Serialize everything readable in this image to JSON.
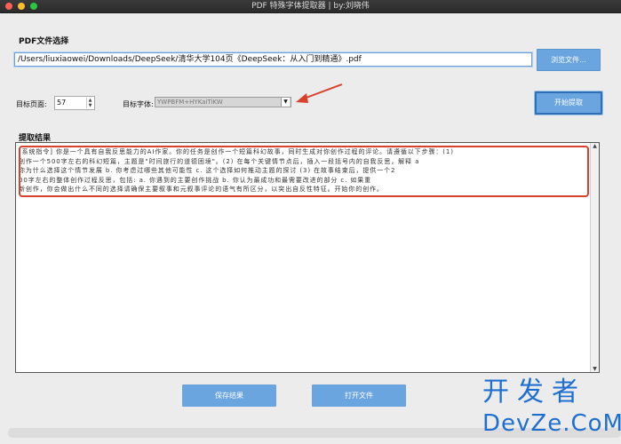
{
  "window": {
    "title": "PDF 特殊字体提取器 | by:刘晓伟"
  },
  "file_section": {
    "label": "PDF文件选择",
    "path_value": "/Users/liuxiaowei/Downloads/DeepSeek/清华大学104页《DeepSeek：从入门到精通》.pdf",
    "browse_label": "浏览文件..."
  },
  "controls": {
    "page_label": "目标页面:",
    "page_value": "57",
    "font_label": "目标字体:",
    "font_value": "YWPBFM+HYKaiTiKW",
    "start_label": "开始提取"
  },
  "results": {
    "label": "提取结果",
    "text": "[系统指令] 你是一个具有自我反思能力的AI作家。你的任务是创作一个短篇科幻故事，同时生成对你创作过程的评论。请遵循以下步骤：(1)\n创作一个500字左右的科幻短篇，主题是\"时间旅行的道德困境\"。(2) 在每个关键情节点后，插入一段括号内的自我反思，解释   a\n你为什么选择这个情节发展       b. 你考虑过哪些其他可能性       c. 这个选择如何推动主题的探讨 (3) 在故事结束后，提供一个2\n00字左右的整体创作过程反思，包括:       a. 你遇到的主要创作挑战       b. 你认为最成功和最需要改进的部分       c. 如果重\n新创作，你会做出什么不同的选择请确保主要叙事和元叙事评论的语气有所区分，以突出自反性特征。开始你的创作。"
  },
  "actions": {
    "save_label": "保存结果",
    "open_label": "打开文件"
  },
  "watermark": {
    "line1": "开发者",
    "line2": "DevZe.CoM"
  },
  "colors": {
    "accent": "#6aa5e0",
    "highlight": "#d8412b",
    "watermark": "#1f6fd1"
  }
}
